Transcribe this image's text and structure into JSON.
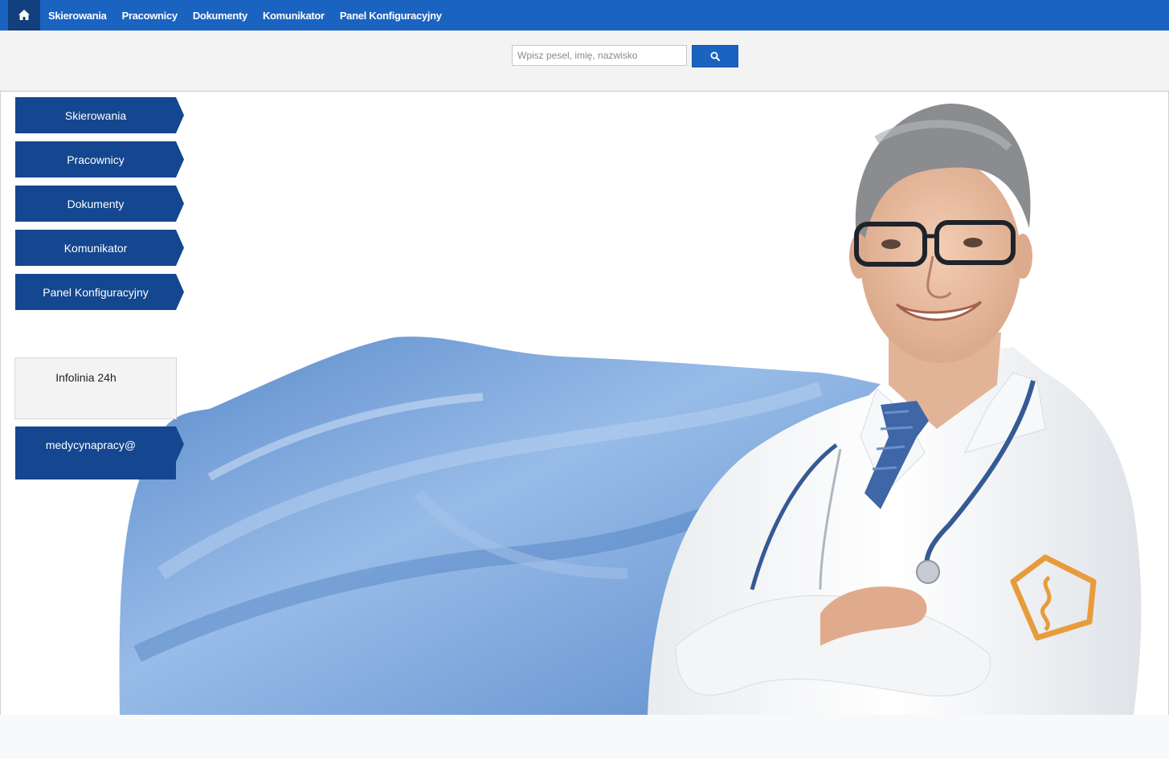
{
  "topnav": {
    "home_icon": "home-icon",
    "items": [
      {
        "label": "Skierowania"
      },
      {
        "label": "Pracownicy"
      },
      {
        "label": "Dokumenty"
      },
      {
        "label": "Komunikator"
      },
      {
        "label": "Panel Konfiguracyjny"
      }
    ]
  },
  "search": {
    "placeholder": "Wpisz pesel, imię, nazwisko",
    "value": "",
    "button_icon": "search-icon"
  },
  "sidebar": {
    "items": [
      {
        "label": "Skierowania"
      },
      {
        "label": "Pracownicy"
      },
      {
        "label": "Dokumenty"
      },
      {
        "label": "Komunikator"
      },
      {
        "label": "Panel Konfiguracyjny"
      }
    ],
    "info_label": "Infolinia 24h",
    "email_label": "medycynapracy@"
  },
  "colors": {
    "topbar": "#1a63c0",
    "home_active": "#123f7e",
    "sidebar_button": "#14478f",
    "cape": "#5d8fd0",
    "emblem": "#e89b3a"
  }
}
